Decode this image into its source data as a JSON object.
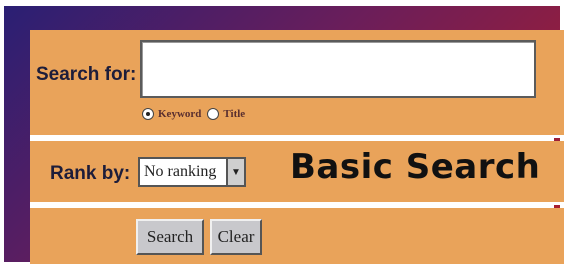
{
  "search": {
    "label": "Search for:",
    "query": "",
    "options": [
      {
        "label": "Keyword",
        "selected": true
      },
      {
        "label": "Title",
        "selected": false
      }
    ]
  },
  "rank": {
    "label": "Rank by:",
    "selected": "No ranking"
  },
  "heading": "Basic Search",
  "buttons": {
    "search": "Search",
    "clear": "Clear"
  },
  "colors": {
    "panel": "#e9a35a",
    "frame_start": "#2a1f74",
    "frame_end": "#b01f2a"
  }
}
